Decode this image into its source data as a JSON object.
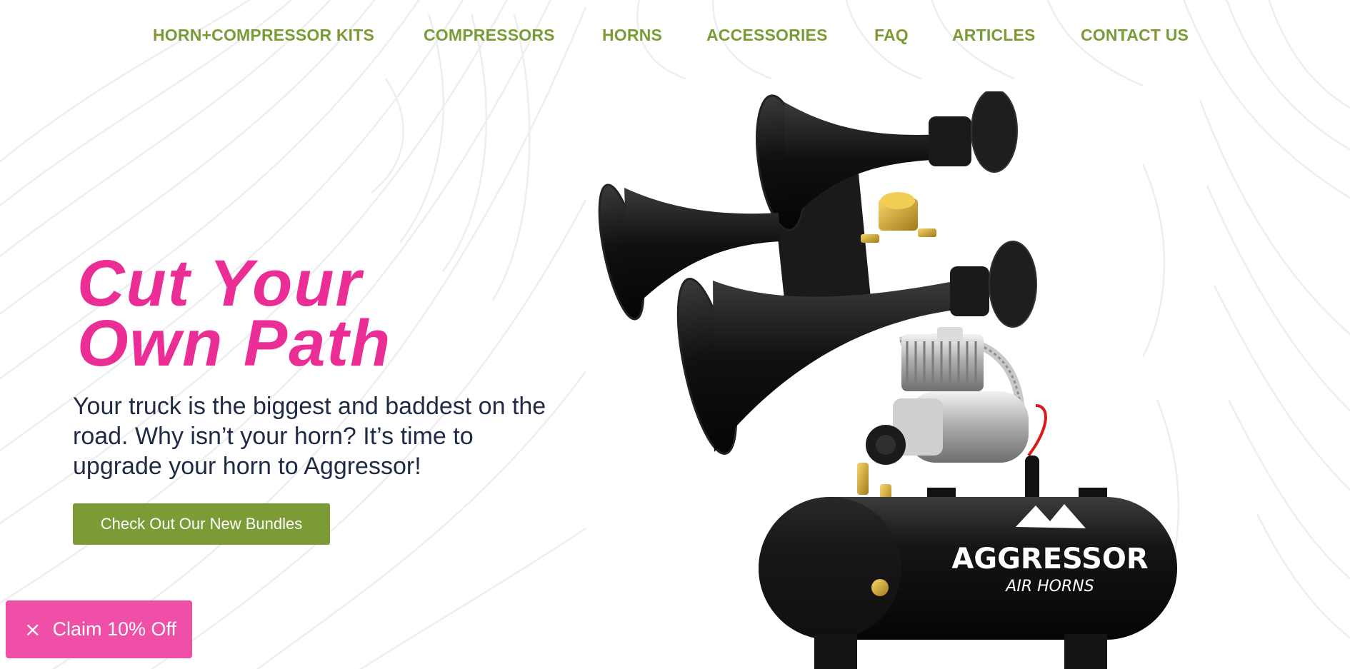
{
  "nav": {
    "items": [
      {
        "label": "HORN+COMPRESSOR KITS"
      },
      {
        "label": "COMPRESSORS"
      },
      {
        "label": "HORNS"
      },
      {
        "label": "ACCESSORIES"
      },
      {
        "label": "FAQ"
      },
      {
        "label": "ARTICLES"
      },
      {
        "label": "CONTACT US"
      }
    ]
  },
  "hero": {
    "title_line1": "Cut Your",
    "title_line2": "Own Path",
    "text": "Your truck is the biggest and baddest on the road. Why isn’t your horn? It’s time to upgrade your horn to Aggressor!",
    "cta_label": "Check Out Our New Bundles"
  },
  "product": {
    "brand_name": "AGGRESSOR",
    "brand_sub": "AIR HORNS"
  },
  "promo": {
    "close_icon": "×",
    "label": "Claim 10% Off"
  },
  "colors": {
    "nav_green": "#7c9a35",
    "title_pink": "#ea2e96",
    "body_text": "#1f2a44",
    "cta_green": "#7c9a35",
    "promo_pink": "#f04fa8"
  }
}
